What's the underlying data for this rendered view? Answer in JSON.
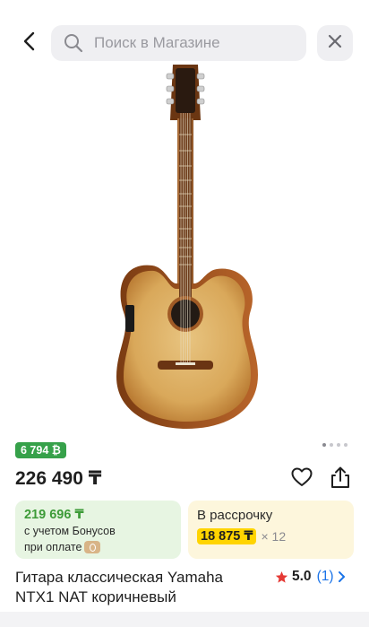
{
  "header": {
    "search_placeholder": "Поиск в Магазине"
  },
  "icons": {
    "back": "chevron-left-icon",
    "search": "magnifier-icon",
    "close": "close-icon",
    "favorite": "heart-icon",
    "share": "share-icon",
    "star": "star-icon"
  },
  "gallery": {
    "image_count": 4,
    "active_index": 0
  },
  "product": {
    "bonus_badge": "6 794 ₿",
    "price": "226 490 ₸",
    "title": "Гитара классическая Yamaha NTX1 NAT коричневый",
    "rating": "5.0",
    "reviews": "(1)"
  },
  "bonus_card": {
    "price": "219 696 ₸",
    "line1": "с учетом Бонусов",
    "line2": "при оплате"
  },
  "installment_card": {
    "title": "В рассрочку",
    "amount": "18 875 ₸",
    "months": "× 12"
  },
  "colors": {
    "accent_green": "#36a14a",
    "installment_yellow": "#ffd400",
    "link_blue": "#1a73e8",
    "star_red": "#e53935"
  }
}
